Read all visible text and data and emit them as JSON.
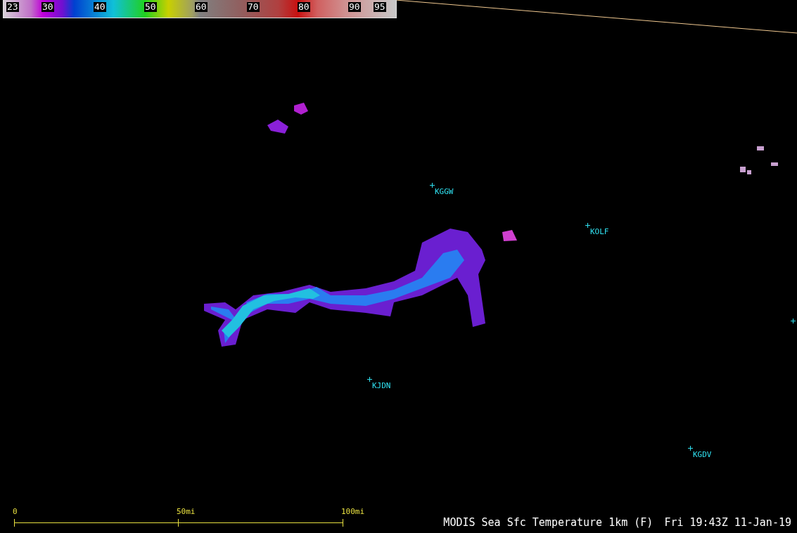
{
  "color_bar": {
    "labels": [
      "23",
      "30",
      "40",
      "50",
      "60",
      "70",
      "80",
      "90",
      "95"
    ]
  },
  "stations": [
    {
      "kind": "labelled",
      "label": "KGGW"
    },
    {
      "kind": "labelled",
      "label": "KOLF"
    },
    {
      "kind": "labelled",
      "label": "KJDN"
    },
    {
      "kind": "labelled",
      "label": "KGDV"
    },
    {
      "kind": "marker"
    }
  ],
  "scale_bar": {
    "labels": [
      "0",
      "50mi",
      "100mi"
    ]
  },
  "product_title": "MODIS Sea Sfc Temperature 1km (F)",
  "timestamp": "Fri 19:43Z 11-Jan-19"
}
